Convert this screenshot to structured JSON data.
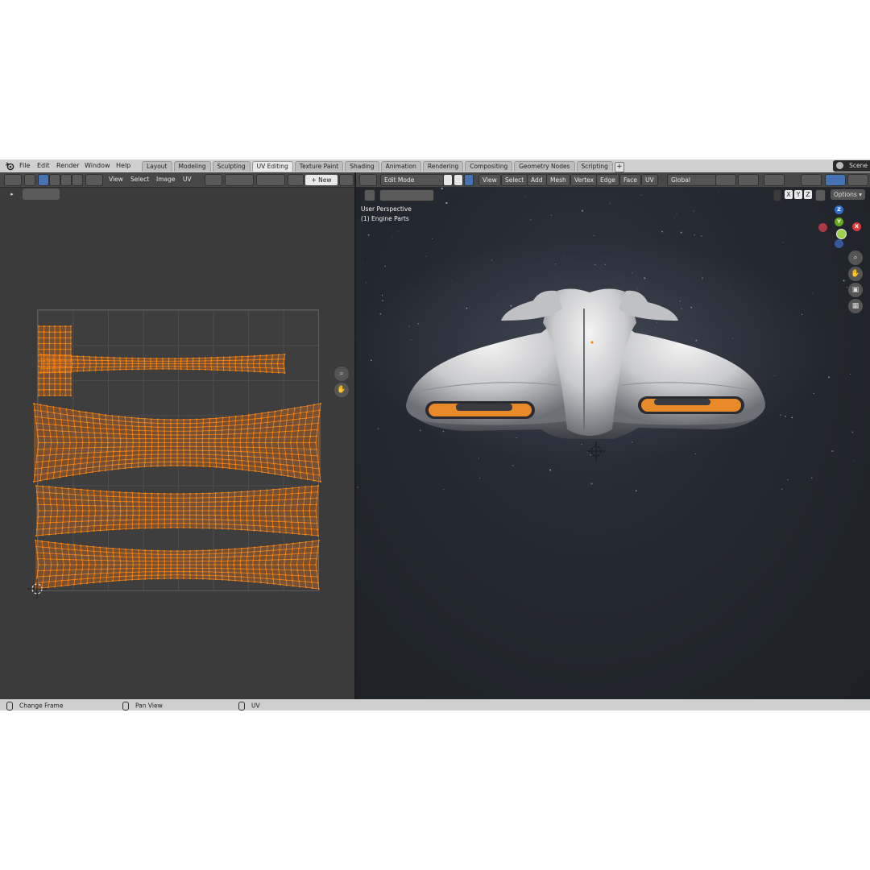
{
  "menu": [
    "File",
    "Edit",
    "Render",
    "Window",
    "Help"
  ],
  "workspaces": [
    {
      "label": "Layout",
      "active": false
    },
    {
      "label": "Modeling",
      "active": false
    },
    {
      "label": "Sculpting",
      "active": false
    },
    {
      "label": "UV Editing",
      "active": true
    },
    {
      "label": "Texture Paint",
      "active": false
    },
    {
      "label": "Shading",
      "active": false
    },
    {
      "label": "Animation",
      "active": false
    },
    {
      "label": "Rendering",
      "active": false
    },
    {
      "label": "Compositing",
      "active": false
    },
    {
      "label": "Geometry Nodes",
      "active": false
    },
    {
      "label": "Scripting",
      "active": false
    }
  ],
  "add_workspace": "+",
  "scene": "Scene",
  "uv_editor": {
    "menus": [
      "View",
      "Select",
      "Image",
      "UV"
    ],
    "new_label": "New"
  },
  "viewport": {
    "mode": "Edit Mode",
    "menus": [
      "View",
      "Select",
      "Add",
      "Mesh",
      "Vertex",
      "Edge",
      "Face",
      "UV"
    ],
    "orientation": "Global",
    "axes": [
      "X",
      "Y",
      "Z"
    ],
    "options_label": "Options",
    "perspective": "User Perspective",
    "object": "(1) Engine Parts"
  },
  "gizmo": {
    "x": "X",
    "y": "Y",
    "z": "Z"
  },
  "statusbar": [
    "Change Frame",
    "Pan View",
    "UV"
  ],
  "colors": {
    "accent": "#4772b3",
    "selection": "#ff8a00",
    "uv_fill": "#e0741a"
  }
}
